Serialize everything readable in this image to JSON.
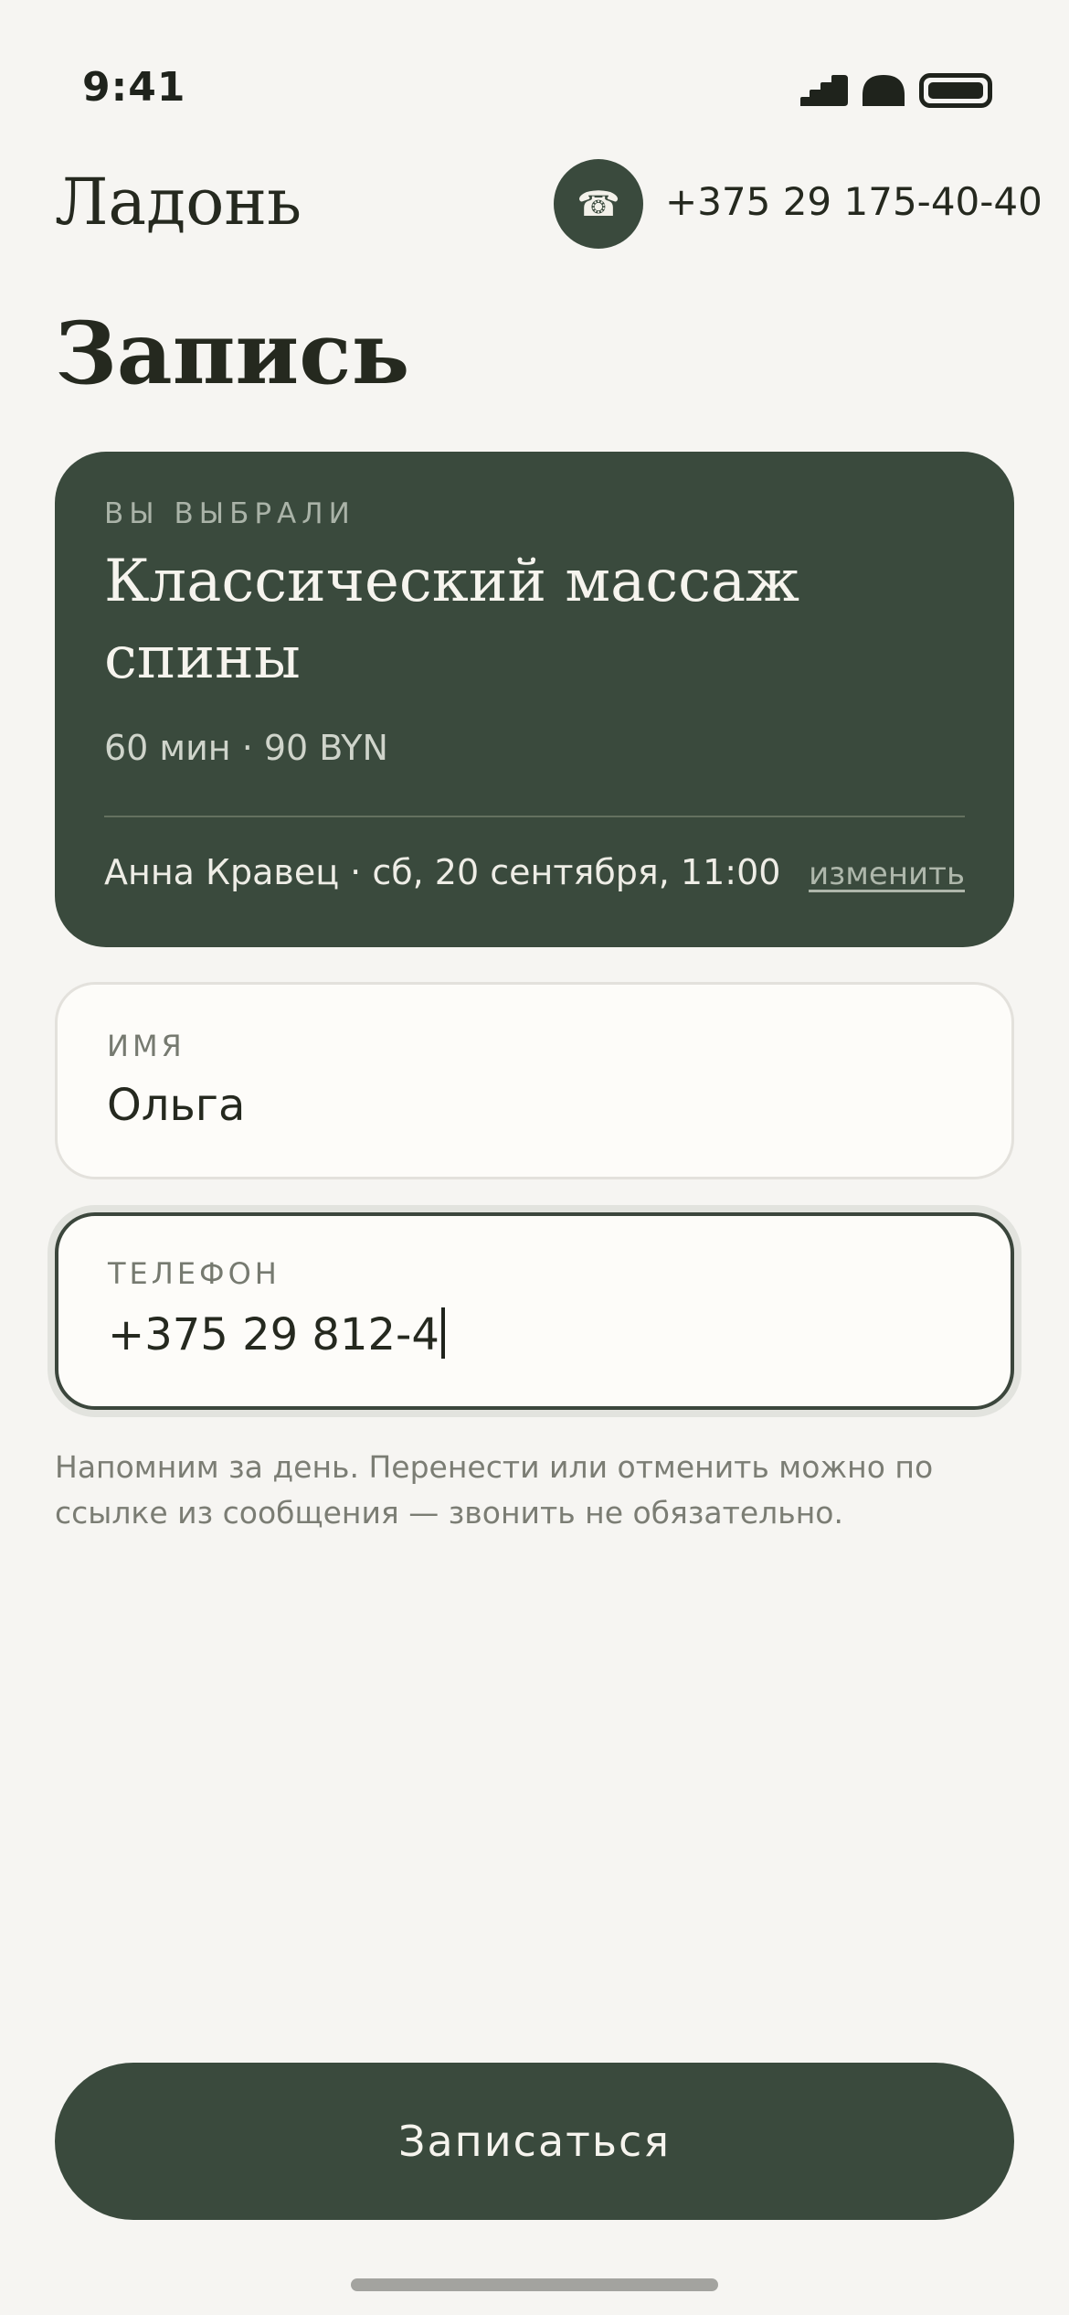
{
  "status": {
    "time": "9:41"
  },
  "header": {
    "brand": "Ладонь",
    "phone_icon": "☎",
    "phone_number": "+375 29 175-40-40"
  },
  "page": {
    "title": "Запись"
  },
  "selection": {
    "eyebrow": "ВЫ ВЫБРАЛИ",
    "service": "Классический массаж спины",
    "meta": "60 мин · 90 BYN",
    "booking": "Анна Кравец · сб, 20 сентября, 11:00",
    "change_label": "изменить"
  },
  "form": {
    "name": {
      "label": "ИМЯ",
      "value": "Ольга"
    },
    "phone": {
      "label": "ТЕЛЕФОН",
      "value": "+375 29 812-4"
    }
  },
  "hint": "Напомним за день. Перенести или отменить можно по ссылке из сообщения — звонить не обязательно.",
  "submit": {
    "label": "Записаться"
  },
  "colors": {
    "accent": "#3a4a3d",
    "background": "#f6f5f2",
    "field_bg": "#fdfcf9"
  }
}
